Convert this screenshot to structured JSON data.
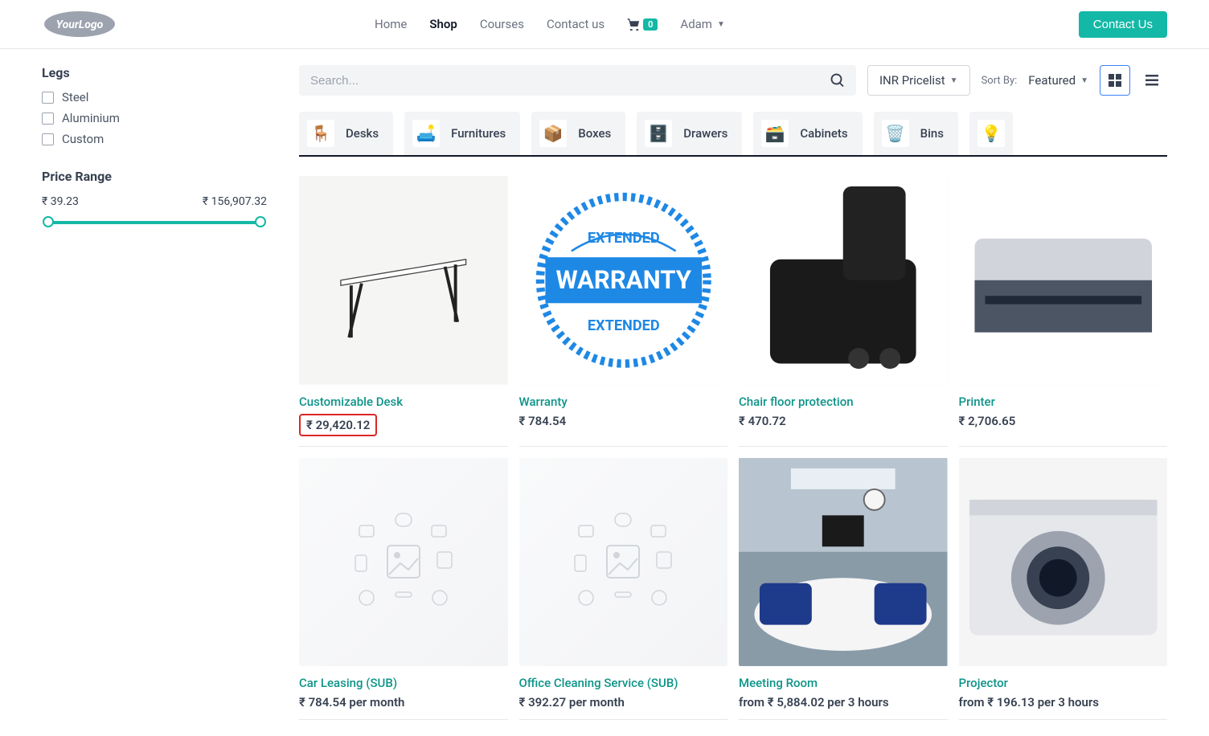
{
  "header": {
    "nav": {
      "home": "Home",
      "shop": "Shop",
      "courses": "Courses",
      "contact": "Contact us"
    },
    "cart_count": "0",
    "user_name": "Adam",
    "contact_btn": "Contact Us"
  },
  "sidebar": {
    "legs_heading": "Legs",
    "legs_options": [
      "Steel",
      "Aluminium",
      "Custom"
    ],
    "price_heading": "Price Range",
    "price_min": "₹ 39.23",
    "price_max": "₹ 156,907.32"
  },
  "toolbar": {
    "search_placeholder": "Search...",
    "pricelist_label": "INR Pricelist",
    "sortby_label": "Sort By:",
    "sortby_value": "Featured"
  },
  "categories": [
    {
      "label": "Desks",
      "icon": "🪑"
    },
    {
      "label": "Furnitures",
      "icon": "🛋️"
    },
    {
      "label": "Boxes",
      "icon": "📦"
    },
    {
      "label": "Drawers",
      "icon": "🗄️"
    },
    {
      "label": "Cabinets",
      "icon": "🗃️"
    },
    {
      "label": "Bins",
      "icon": "🗑️"
    }
  ],
  "products": [
    {
      "name": "Customizable Desk",
      "price": "₹ 29,420.12",
      "highlight": true
    },
    {
      "name": "Warranty",
      "price": "₹ 784.54"
    },
    {
      "name": "Chair floor protection",
      "price": "₹ 470.72"
    },
    {
      "name": "Printer",
      "price": "₹ 2,706.65"
    },
    {
      "name": "Car Leasing (SUB)",
      "price": "₹ 784.54 per month"
    },
    {
      "name": "Office Cleaning Service (SUB)",
      "price": "₹ 392.27 per month"
    },
    {
      "name": "Meeting Room",
      "price": "from ₹ 5,884.02 per 3 hours"
    },
    {
      "name": "Projector",
      "price": "from ₹ 196.13 per 3 hours"
    }
  ]
}
